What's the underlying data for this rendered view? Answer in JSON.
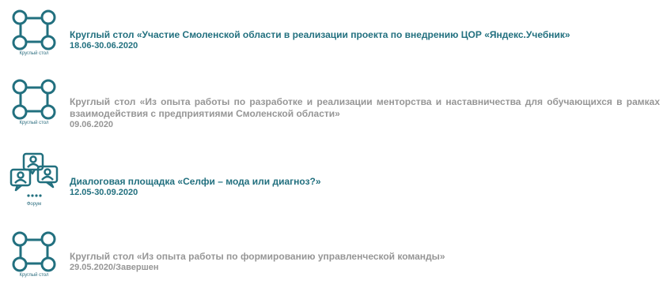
{
  "colors": {
    "accent": "#22707f",
    "muted": "#969696"
  },
  "events": [
    {
      "icon": "round-table-icon",
      "icon_caption": "Круглый стол",
      "title": "Круглый стол «Участие Смоленской области в реализации проекта по внедрению ЦОР «Яндекс.Учебник»",
      "date": "18.06-30.06.2020",
      "status": "active"
    },
    {
      "icon": "round-table-icon",
      "icon_caption": "Круглый стол",
      "title": "Круглый стол «Из опыта работы по разработке и реализации менторства и наставничества для обучающихся в рамках взаимодействия с предприятиями Смоленской области»",
      "date": "09.06.2020",
      "status": "past"
    },
    {
      "icon": "forum-icon",
      "icon_caption": "Форум",
      "title": "Диалоговая площадка «Селфи – мода или диагноз?»",
      "date": "12.05-30.09.2020",
      "status": "active"
    },
    {
      "icon": "round-table-icon",
      "icon_caption": "Круглый стол",
      "title": "Круглый стол «Из опыта работы по формированию управленческой команды»",
      "date": "29.05.2020/Завершен",
      "status": "finished"
    }
  ]
}
